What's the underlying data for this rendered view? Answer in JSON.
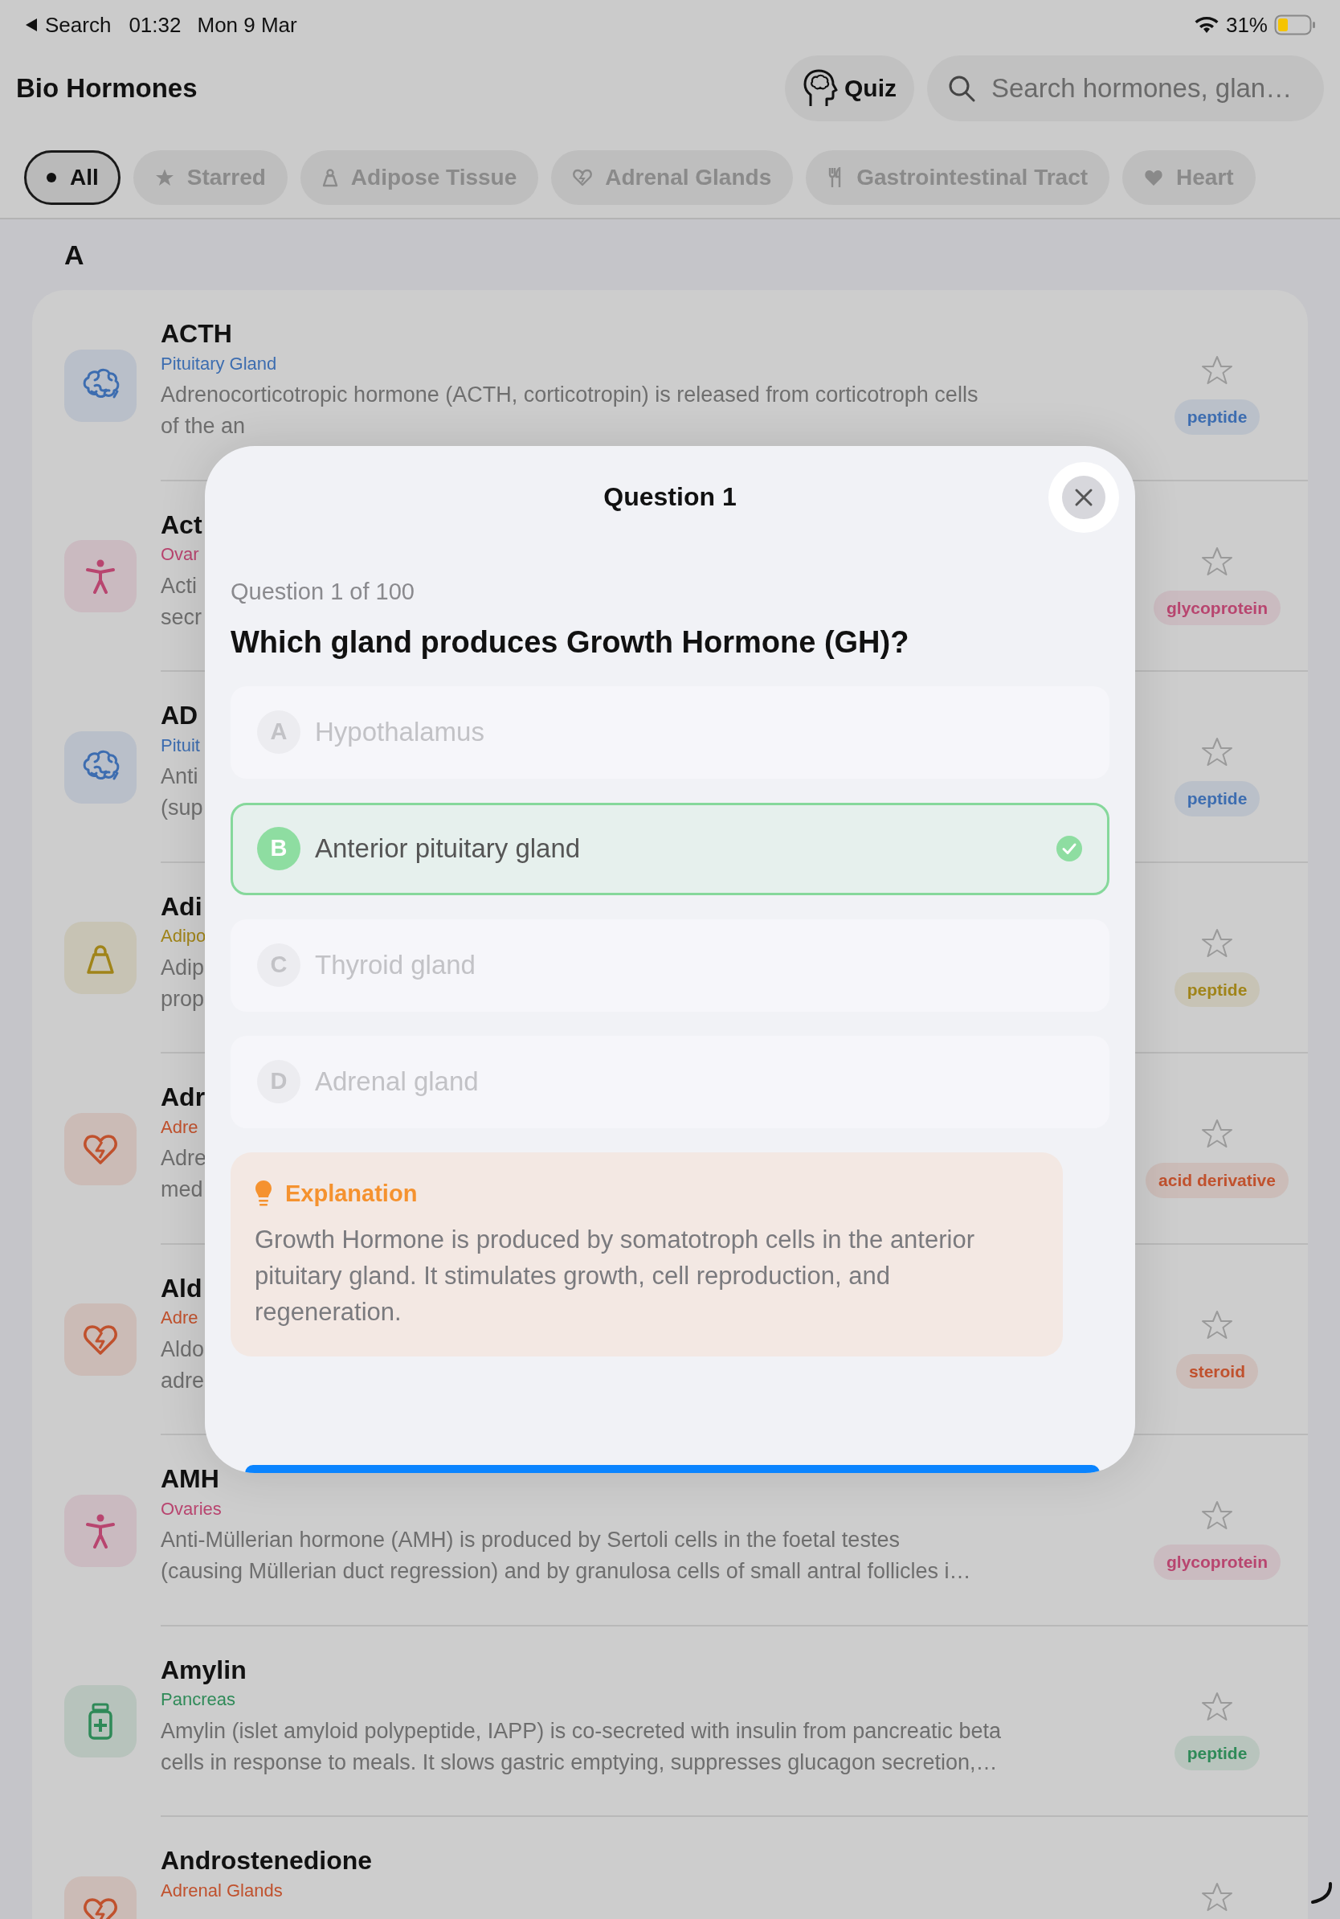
{
  "status_bar": {
    "back_label": "Search",
    "time": "01:32",
    "date": "Mon 9 Mar",
    "battery": "31%"
  },
  "header": {
    "title": "Bio Hormones",
    "quiz_button": "Quiz",
    "search": {
      "placeholder": "Search hormones, glan…"
    }
  },
  "filters": [
    {
      "label": "All",
      "selected": true,
      "kind": "dot"
    },
    {
      "label": "Starred",
      "selected": false,
      "kind": "star"
    },
    {
      "label": "Adipose Tissue",
      "selected": false,
      "kind": "weight"
    },
    {
      "label": "Adrenal Glands",
      "selected": false,
      "kind": "heart-bolt"
    },
    {
      "label": "Gastrointestinal Tract",
      "selected": false,
      "kind": "fork"
    },
    {
      "label": "Heart",
      "selected": false,
      "kind": "heart"
    }
  ],
  "section": "A",
  "hormones": [
    {
      "kind": "brain",
      "color": "#3d6db0",
      "name": "ACTH",
      "gland": "Pituitary Gland",
      "description": [
        "Adrenocorticotropic hormone (ACTH, corticotropin) is released from corticotroph cells",
        "of the an"
      ],
      "starred": false,
      "type": "peptide"
    },
    {
      "kind": "figure",
      "color": "#b8456f",
      "name": "Act",
      "gland": "Ovar",
      "description": [
        "Acti",
        "secr"
      ],
      "starred": false,
      "type": "glycoprotein"
    },
    {
      "kind": "brain",
      "color": "#3d6db0",
      "name": "AD",
      "gland": "Pituit",
      "description": [
        "Anti",
        "(sup"
      ],
      "starred": false,
      "type": "peptide"
    },
    {
      "kind": "weight",
      "color": "#a08419",
      "name": "Adi",
      "gland": "Adipo",
      "description": [
        "Adip",
        "prop"
      ],
      "starred": false,
      "type": "peptide"
    },
    {
      "kind": "heart-bolt",
      "color": "#c0512d",
      "name": "Adr",
      "gland": "Adre",
      "description": [
        "Adre",
        "med"
      ],
      "starred": false,
      "type": "acid derivative"
    },
    {
      "kind": "heart-bolt",
      "color": "#c0512d",
      "name": "Ald",
      "gland": "Adre",
      "description": [
        "Aldo",
        "adre"
      ],
      "starred": false,
      "type": "steroid"
    },
    {
      "kind": "figure",
      "color": "#b8456f",
      "name": "AMH",
      "gland": "Ovaries",
      "description": [
        "Anti-Müllerian hormone (AMH) is produced by Sertoli cells in the foetal testes",
        "(causing Müllerian duct regression) and by granulosa cells of small antral follicles i…"
      ],
      "starred": false,
      "type": "glycoprotein"
    },
    {
      "kind": "bottle",
      "color": "#2f8a58",
      "name": "Amylin",
      "gland": "Pancreas",
      "description": [
        "Amylin (islet amyloid polypeptide, IAPP) is co-secreted with insulin from pancreatic beta",
        "cells in response to meals. It slows gastric emptying, suppresses glucagon secretion,…"
      ],
      "starred": false,
      "type": "peptide"
    },
    {
      "kind": "heart-bolt",
      "color": "#c0512d",
      "name": "Androstenedione",
      "gland": "Adrenal Glands",
      "starred": false
    }
  ],
  "quiz": {
    "title": "Question 1",
    "progress": "Question 1 of 100",
    "question": "Which gland produces Growth Hormone (GH)?",
    "options": [
      {
        "letter": "A",
        "text": "Hypothalamus",
        "selected": false
      },
      {
        "letter": "B",
        "text": "Anterior pituitary gland",
        "selected": true
      },
      {
        "letter": "C",
        "text": "Thyroid gland",
        "selected": false
      },
      {
        "letter": "D",
        "text": "Adrenal gland",
        "selected": false
      }
    ],
    "explanation": {
      "title": "Explanation",
      "text": "Growth Hormone is produced by somatotroph cells in the anterior pituitary gland. It stimulates growth, cell reproduction, and regeneration."
    }
  }
}
